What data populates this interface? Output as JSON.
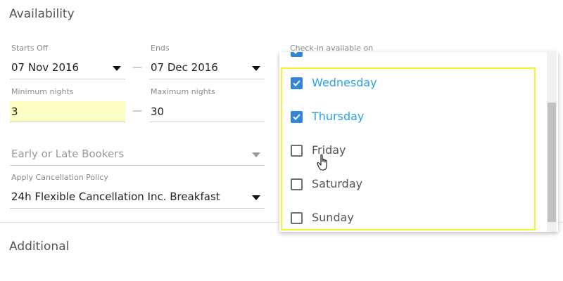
{
  "sections": {
    "availability_title": "Availability",
    "additional_title": "Additional"
  },
  "starts_off": {
    "label": "Starts Off",
    "value": "07 Nov 2016"
  },
  "ends": {
    "label": "Ends",
    "value": "07 Dec 2016"
  },
  "minimum_nights": {
    "label": "Minimum nights",
    "value": "3"
  },
  "maximum_nights": {
    "label": "Maximum nights",
    "value": "30"
  },
  "separator": "—",
  "early_late_bookers": {
    "placeholder": "Early or Late Bookers"
  },
  "cancellation": {
    "label": "Apply Cancellation Policy",
    "value": "24h Flexible Cancellation Inc. Breakfast"
  },
  "checkin": {
    "label": "Check-in available on",
    "days": [
      {
        "label": "Wednesday",
        "checked": true
      },
      {
        "label": "Thursday",
        "checked": true
      },
      {
        "label": "Friday",
        "checked": false
      },
      {
        "label": "Saturday",
        "checked": false
      },
      {
        "label": "Sunday",
        "checked": false
      }
    ]
  },
  "colors": {
    "accent": "#2aa3e6",
    "checkbox_checked": "#2f86d6",
    "highlight_field": "#fbfdc2",
    "highlight_box": "#f2f232"
  },
  "icons": {
    "caret": "caret-down-icon",
    "checkmark": "checkmark-icon",
    "cursor": "hand-pointer-icon"
  }
}
